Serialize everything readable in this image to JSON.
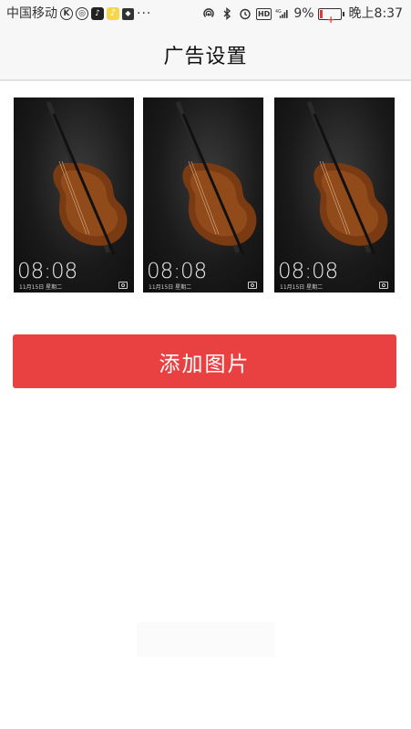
{
  "status_bar": {
    "carrier": "中国移动",
    "battery_percent": "9%",
    "time": "晚上8:37",
    "network": "4G",
    "icons": [
      "k-app-icon",
      "weibo-icon",
      "tiktok-icon",
      "music-icon",
      "cat-app-icon",
      "more-dots-icon",
      "hotspot-icon",
      "bluetooth-icon",
      "alarm-icon",
      "hd-icon",
      "signal-icon",
      "battery-icon"
    ]
  },
  "header": {
    "title": "广告设置"
  },
  "images": [
    {
      "clock": "08:08",
      "date": "11月15日 星期二"
    },
    {
      "clock": "08:08",
      "date": "11月15日 星期二"
    },
    {
      "clock": "08:08",
      "date": "11月15日 星期二"
    }
  ],
  "actions": {
    "add_image_label": "添加图片"
  },
  "colors": {
    "accent": "#e94141",
    "navbar_bg": "#f7f7f7"
  }
}
